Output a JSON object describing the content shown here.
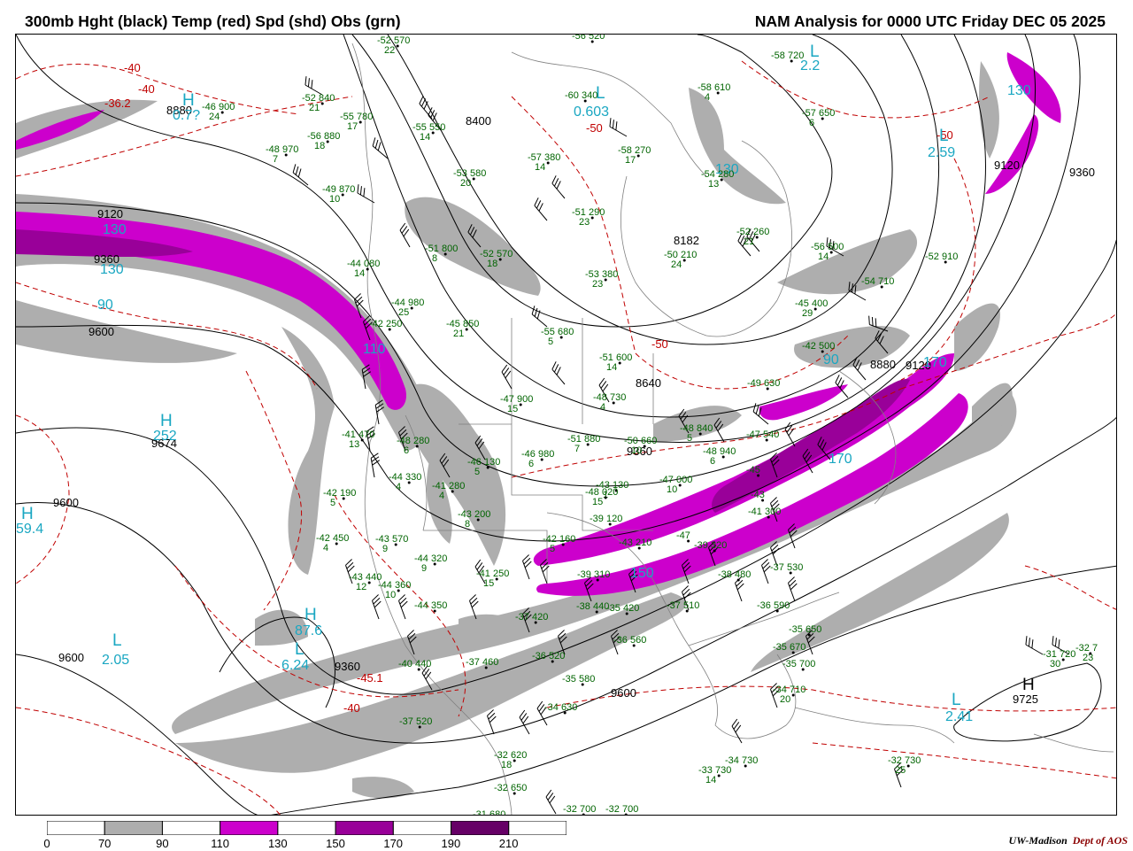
{
  "header": {
    "left_title": "300mb Hght (black) Temp (red) Spd (shd) Obs (grn)",
    "right_title": "NAM Analysis for 0000 UTC Friday  DEC 05 2025"
  },
  "colors": {
    "height_contour": "#000000",
    "temperature_contour": "#c00000",
    "obs": "#006400",
    "pressure_centers": "#1aa7c2",
    "map_outline": "#808080",
    "speed_70_90": "#aeaeae",
    "speed_110_130": "#cc00cc",
    "speed_150_170": "#990099",
    "speed_190_210": "#660066"
  },
  "height_labels": [
    {
      "text": "8400"
    },
    {
      "text": "8640"
    },
    {
      "text": "8880"
    },
    {
      "text": "8880"
    },
    {
      "text": "8182"
    },
    {
      "text": "9120"
    },
    {
      "text": "9120"
    },
    {
      "text": "9120"
    },
    {
      "text": "9360"
    },
    {
      "text": "9360"
    },
    {
      "text": "9360"
    },
    {
      "text": "9360"
    },
    {
      "text": "9600"
    },
    {
      "text": "9600"
    },
    {
      "text": "9600"
    },
    {
      "text": "9600"
    },
    {
      "text": "9674"
    },
    {
      "text": "9725"
    }
  ],
  "temperature_labels": [
    {
      "text": "-40"
    },
    {
      "text": "-40"
    },
    {
      "text": "-36.2"
    },
    {
      "text": "-50"
    },
    {
      "text": "-50"
    },
    {
      "text": "-50"
    },
    {
      "text": "-45.1"
    },
    {
      "text": "-40"
    }
  ],
  "centers": [
    {
      "symbol": "H",
      "value": "0.7?"
    },
    {
      "symbol": "L",
      "value": "0.603"
    },
    {
      "symbol": "L",
      "value": "2.59"
    },
    {
      "symbol": "L",
      "value": "2.2"
    },
    {
      "symbol": "H",
      "value": "252"
    },
    {
      "symbol": "H",
      "value": "59.4"
    },
    {
      "symbol": "H",
      "value": "87.6"
    },
    {
      "symbol": "L",
      "value": "6.24"
    },
    {
      "symbol": "L",
      "value": "2.05"
    },
    {
      "symbol": "L",
      "value": "2.41"
    },
    {
      "symbol": "H",
      "value": "9725"
    }
  ],
  "speed_labels": [
    {
      "text": "130"
    },
    {
      "text": "130"
    },
    {
      "text": "90"
    },
    {
      "text": "130"
    },
    {
      "text": "110"
    },
    {
      "text": "90"
    },
    {
      "text": "150"
    },
    {
      "text": "170"
    },
    {
      "text": "130"
    },
    {
      "text": "170"
    }
  ],
  "observations": [
    {
      "temp": "-52",
      "hgt": "570",
      "spd": "22"
    },
    {
      "temp": "-58",
      "hgt": "720",
      "spd": ""
    },
    {
      "temp": "-56",
      "hgt": "520",
      "spd": ""
    },
    {
      "temp": "-46",
      "hgt": "900",
      "spd": "24"
    },
    {
      "temp": "-52",
      "hgt": "840",
      "spd": "21"
    },
    {
      "temp": "-55",
      "hgt": "780",
      "spd": "17"
    },
    {
      "temp": "-60",
      "hgt": "340",
      "spd": ""
    },
    {
      "temp": "-58",
      "hgt": "610",
      "spd": "4"
    },
    {
      "temp": "-57",
      "hgt": "650",
      "spd": "6"
    },
    {
      "temp": "-55",
      "hgt": "550",
      "spd": "14"
    },
    {
      "temp": "-56",
      "hgt": "880",
      "spd": "18"
    },
    {
      "temp": "-48",
      "hgt": "970",
      "spd": "7"
    },
    {
      "temp": "-57",
      "hgt": "380",
      "spd": "14"
    },
    {
      "temp": "-58",
      "hgt": "270",
      "spd": "17"
    },
    {
      "temp": "-53",
      "hgt": "580",
      "spd": "20"
    },
    {
      "temp": "-54",
      "hgt": "280",
      "spd": "13"
    },
    {
      "temp": "-49",
      "hgt": "870",
      "spd": "10"
    },
    {
      "temp": "-51",
      "hgt": "290",
      "spd": "23"
    },
    {
      "temp": "-52",
      "hgt": "260",
      "spd": "21"
    },
    {
      "temp": "-51",
      "hgt": "800",
      "spd": "8"
    },
    {
      "temp": "-52",
      "hgt": "570",
      "spd": "18"
    },
    {
      "temp": "-50",
      "hgt": "210",
      "spd": "24"
    },
    {
      "temp": "-56",
      "hgt": "500",
      "spd": "14"
    },
    {
      "temp": "-52",
      "hgt": "910",
      "spd": ""
    },
    {
      "temp": "-44",
      "hgt": "080",
      "spd": "14"
    },
    {
      "temp": "-53",
      "hgt": "380",
      "spd": "23"
    },
    {
      "temp": "-54",
      "hgt": "710",
      "spd": ""
    },
    {
      "temp": "-44",
      "hgt": "980",
      "spd": "25"
    },
    {
      "temp": "-45",
      "hgt": "400",
      "spd": "29"
    },
    {
      "temp": "-45",
      "hgt": "850",
      "spd": "21"
    },
    {
      "temp": "-55",
      "hgt": "680",
      "spd": "5"
    },
    {
      "temp": "-42",
      "hgt": "250",
      "spd": ""
    },
    {
      "temp": "-51",
      "hgt": "600",
      "spd": "14"
    },
    {
      "temp": "-42",
      "hgt": "500",
      "spd": ""
    },
    {
      "temp": "-49",
      "hgt": "630",
      "spd": ""
    },
    {
      "temp": "-47",
      "hgt": "900",
      "spd": "15"
    },
    {
      "temp": "-48",
      "hgt": "730",
      "spd": "4"
    },
    {
      "temp": "-41",
      "hgt": "470",
      "spd": "13"
    },
    {
      "temp": "-48",
      "hgt": "280",
      "spd": "6"
    },
    {
      "temp": "-50",
      "hgt": "660",
      "spd": "10"
    },
    {
      "temp": "-51",
      "hgt": "880",
      "spd": "7"
    },
    {
      "temp": "-48",
      "hgt": "840",
      "spd": "5"
    },
    {
      "temp": "-47",
      "hgt": "540",
      "spd": ""
    },
    {
      "temp": "-46",
      "hgt": "130",
      "spd": "5"
    },
    {
      "temp": "-46",
      "hgt": "980",
      "spd": "6"
    },
    {
      "temp": "-48",
      "hgt": "940",
      "spd": "6"
    },
    {
      "temp": "-44",
      "hgt": "330",
      "spd": "4"
    },
    {
      "temp": "-41",
      "hgt": "280",
      "spd": "4"
    },
    {
      "temp": "-42",
      "hgt": "190",
      "spd": "5"
    },
    {
      "temp": "-47",
      "hgt": "000",
      "spd": "10"
    },
    {
      "temp": "-43",
      "hgt": "130",
      "spd": "1"
    },
    {
      "temp": "-48",
      "hgt": "020",
      "spd": "15"
    },
    {
      "temp": "-42",
      "hgt": "450",
      "spd": "4"
    },
    {
      "temp": "-43",
      "hgt": "570",
      "spd": "9"
    },
    {
      "temp": "-43",
      "hgt": "200",
      "spd": "8"
    },
    {
      "temp": "-41",
      "hgt": "300",
      "spd": ""
    },
    {
      "temp": "-42",
      "hgt": "160",
      "spd": "5"
    },
    {
      "temp": "-43",
      "hgt": "210",
      "spd": ""
    },
    {
      "temp": "-39",
      "hgt": "120",
      "spd": ""
    },
    {
      "temp": "-39",
      "hgt": "320",
      "spd": ""
    },
    {
      "temp": "-44",
      "hgt": "320",
      "spd": "9"
    },
    {
      "temp": "-43",
      "hgt": "440",
      "spd": "12"
    },
    {
      "temp": "-44",
      "hgt": "360",
      "spd": "10"
    },
    {
      "temp": "-44",
      "hgt": "350",
      "spd": ""
    },
    {
      "temp": "-41",
      "hgt": "250",
      "spd": "15"
    },
    {
      "temp": "-39",
      "hgt": "310",
      "spd": ""
    },
    {
      "temp": "-38",
      "hgt": "480",
      "spd": ""
    },
    {
      "temp": "-37",
      "hgt": "530",
      "spd": ""
    },
    {
      "temp": "-37",
      "hgt": "420",
      "spd": ""
    },
    {
      "temp": "-38",
      "hgt": "440",
      "spd": ""
    },
    {
      "temp": "-35",
      "hgt": "420",
      "spd": ""
    },
    {
      "temp": "-37",
      "hgt": "510",
      "spd": ""
    },
    {
      "temp": "-36",
      "hgt": "590",
      "spd": ""
    },
    {
      "temp": "-35",
      "hgt": "650",
      "spd": ""
    },
    {
      "temp": "-36",
      "hgt": "560",
      "spd": ""
    },
    {
      "temp": "-35",
      "hgt": "670",
      "spd": ""
    },
    {
      "temp": "-35",
      "hgt": "700",
      "spd": ""
    },
    {
      "temp": "-34",
      "hgt": "710",
      "spd": "20"
    },
    {
      "temp": "-40",
      "hgt": "440",
      "spd": ""
    },
    {
      "temp": "-37",
      "hgt": "460",
      "spd": ""
    },
    {
      "temp": "-36",
      "hgt": "520",
      "spd": ""
    },
    {
      "temp": "-35",
      "hgt": "580",
      "spd": ""
    },
    {
      "temp": "-34",
      "hgt": "630",
      "spd": ""
    },
    {
      "temp": "-37",
      "hgt": "520",
      "spd": ""
    },
    {
      "temp": "-32",
      "hgt": "620",
      "spd": "18"
    },
    {
      "temp": "-32",
      "hgt": "650",
      "spd": ""
    },
    {
      "temp": "-31",
      "hgt": "680",
      "spd": ""
    },
    {
      "temp": "-32",
      "hgt": "700",
      "spd": ""
    },
    {
      "temp": "-32",
      "hgt": "700",
      "spd": ""
    },
    {
      "temp": "-33",
      "hgt": "730",
      "spd": "14"
    },
    {
      "temp": "-34",
      "hgt": "730",
      "spd": ""
    },
    {
      "temp": "-32",
      "hgt": "730",
      "spd": "25"
    },
    {
      "temp": "-31",
      "hgt": "720",
      "spd": "30"
    },
    {
      "temp": "-32",
      "hgt": "7",
      "spd": "23"
    },
    {
      "temp": "-43",
      "hgt": "",
      "spd": ""
    },
    {
      "temp": "-47",
      "hgt": "",
      "spd": ""
    },
    {
      "temp": "-45",
      "hgt": "",
      "spd": ""
    }
  ],
  "colorbar": {
    "ticks": [
      "0",
      "70",
      "90",
      "110",
      "130",
      "150",
      "170",
      "190",
      "210"
    ],
    "colors": [
      "#ffffff",
      "#aeaeae",
      "#ffffff",
      "#cc00cc",
      "#ffffff",
      "#990099",
      "#ffffff",
      "#660066",
      "#ffffff"
    ]
  },
  "credit": {
    "org": "UW-Madison",
    "dept": "Dept of AOS"
  }
}
